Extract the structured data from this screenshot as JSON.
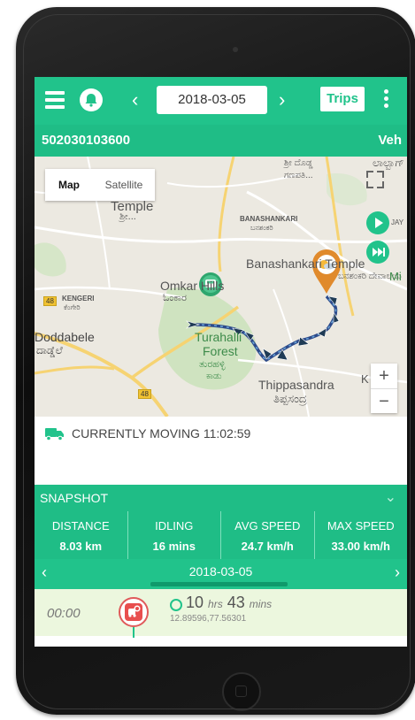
{
  "header": {
    "date": "2018-03-05",
    "trips_label": "Trips",
    "prev": "‹",
    "next": "›"
  },
  "vehicle": {
    "id": "502030103600",
    "short": "Veh"
  },
  "map": {
    "type_buttons": [
      "Map",
      "Satellite"
    ],
    "zoom_in": "+",
    "zoom_out": "−",
    "labels": {
      "temple": "Temple",
      "temple_local": "ಶ್ರೀ...",
      "banashankari": "BANASHANKARI",
      "banashankari_local": "ಬನಶಂಕರಿ",
      "banashankari_temple": "Banashankari Temple",
      "banashankari_temple_local": "ಬನಶಂಕರಿ ದೇವಾಲಯ",
      "omkar": "Omkar Hills",
      "omkar_local": "ಓಂಕಾರ",
      "kengeri": "KENGERI",
      "kengeri_local": "ಕೆಂಗೇರಿ",
      "doddabele": "Doddabele",
      "doddabele_local": "ದಾಡ್ಡೆಲೆ",
      "turahalli": "Turahalli",
      "forest": "Forest",
      "forest_local": "ತುರಹಳ್ಳಿ",
      "forest_local2": "ಕಾಡು",
      "thippasandra": "Thippasandra",
      "thippasandra_local": "ತಿಪ್ಪಸಂದ್ರ",
      "ganapathi_local": "ಶ್ರೀ ದೊಡ್ಡ",
      "ganapathi_local2": "ಗಣಪತಿ...",
      "top_right": "ಲಾಲ್ಬಾಗ್",
      "route48": "48",
      "mini": "Mi",
      "ja": "JAY",
      "k": "K"
    }
  },
  "status": {
    "text": "CURRENTLY MOVING 11:02:59"
  },
  "snapshot": {
    "label": "SNAPSHOT",
    "stats": [
      {
        "label": "DISTANCE",
        "value": "8.03 km"
      },
      {
        "label": "IDLING",
        "value": "16 mins"
      },
      {
        "label": "AVG SPEED",
        "value": "24.7 km/h"
      },
      {
        "label": "MAX SPEED",
        "value": "33.00 km/h"
      }
    ],
    "date": "2018-03-05"
  },
  "trip": {
    "time": "00:00",
    "hours": "10",
    "hours_unit": "hrs",
    "mins": "43",
    "mins_unit": "mins",
    "coords": "12.89596,77.56301"
  },
  "colors": {
    "accent": "#21c38b",
    "route": "#2d4a8a"
  }
}
